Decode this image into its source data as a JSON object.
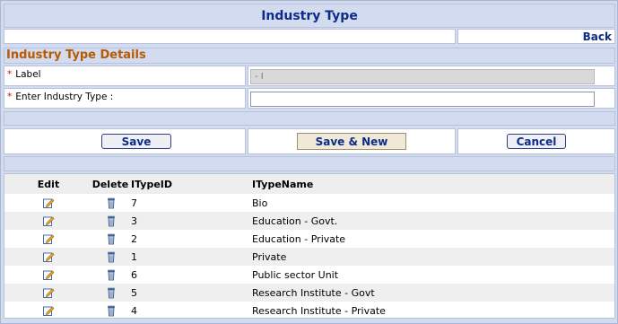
{
  "page": {
    "title": "Industry Type",
    "back_label": "Back"
  },
  "form": {
    "section_title": "Industry Type Details",
    "required_mark": "*",
    "label_field": {
      "label": "Label",
      "value": "- I"
    },
    "industry_field": {
      "label": "Enter Industry Type :",
      "value": ""
    },
    "buttons": {
      "save": "Save",
      "save_new": "Save & New",
      "cancel": "Cancel"
    }
  },
  "grid": {
    "columns": [
      "Edit",
      "Delete",
      "ITypeID",
      "ITypeName"
    ],
    "rows": [
      {
        "id": "7",
        "name": "Bio"
      },
      {
        "id": "3",
        "name": "Education - Govt."
      },
      {
        "id": "2",
        "name": "Education - Private"
      },
      {
        "id": "1",
        "name": "Private"
      },
      {
        "id": "6",
        "name": "Public sector Unit"
      },
      {
        "id": "5",
        "name": "Research Institute - Govt"
      },
      {
        "id": "4",
        "name": "Research Institute - Private"
      }
    ],
    "icons": {
      "edit": "edit-pencil-icon",
      "delete": "trash-icon"
    }
  },
  "colors": {
    "frame": "#d3dbef",
    "title_text": "#0d2c8a",
    "section_text": "#b85a00",
    "required": "#d01010"
  }
}
